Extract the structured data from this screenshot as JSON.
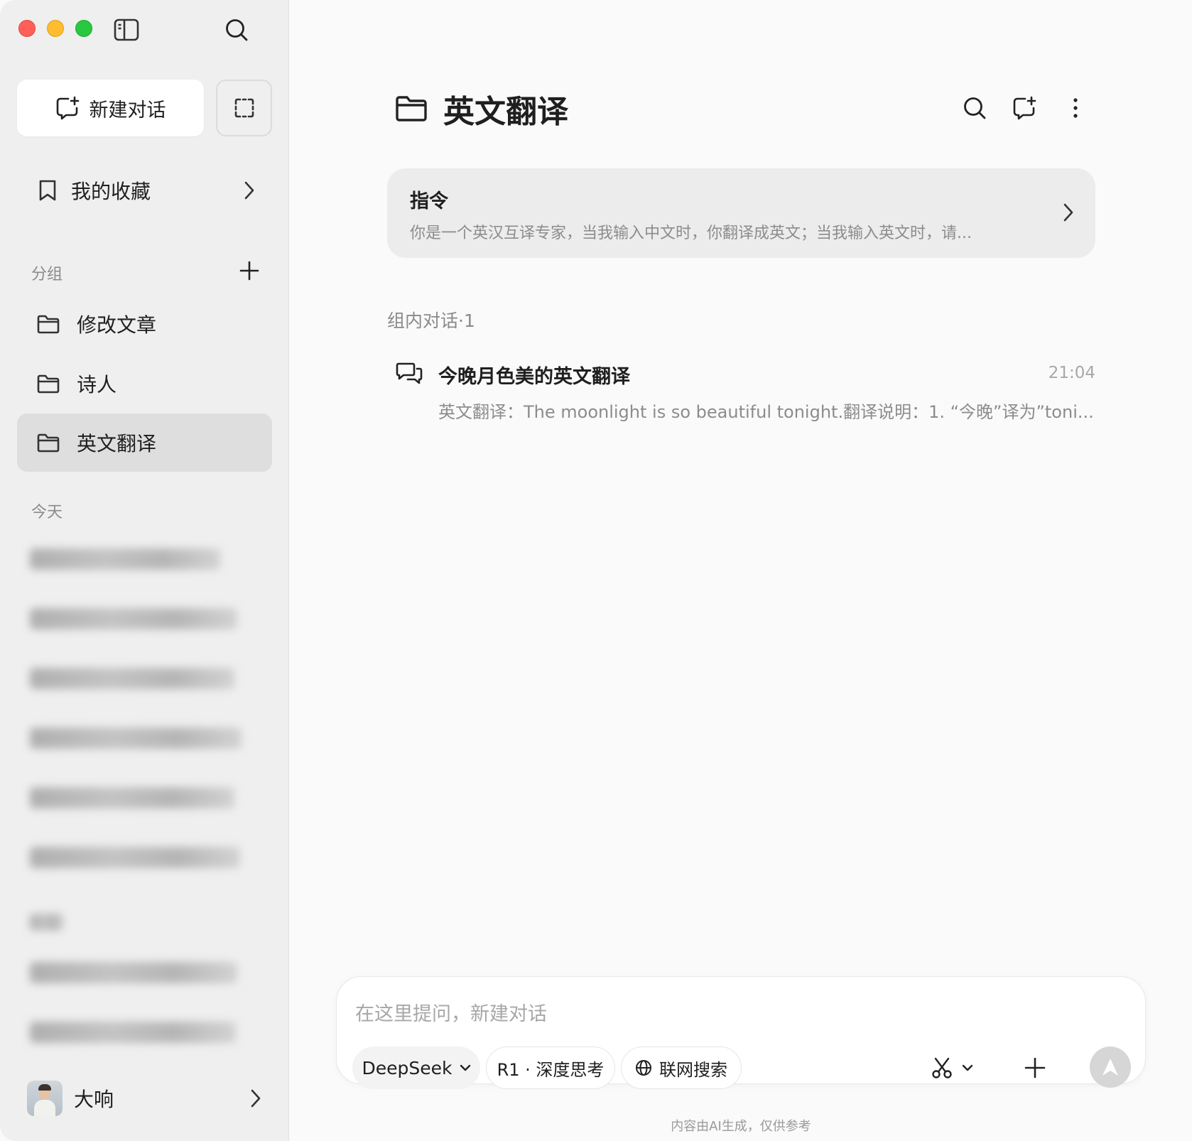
{
  "sidebar": {
    "new_chat_label": "新建对话",
    "favorites_label": "我的收藏",
    "groups_section_label": "分组",
    "groups": [
      {
        "label": "修改文章",
        "active": false
      },
      {
        "label": "诗人",
        "active": false
      },
      {
        "label": "英文翻译",
        "active": true
      }
    ],
    "today_section_label": "今天",
    "user_name": "大响"
  },
  "main": {
    "title": "英文翻译",
    "instruction": {
      "title": "指令",
      "text": "你是一个英汉互译专家，当我输入中文时，你翻译成英文；当我输入英文时，请..."
    },
    "group_conversations_label": "组内对话·1",
    "conversations": [
      {
        "title": "今晚月色美的英文翻译",
        "time": "21:04",
        "preview": "英文翻译：The moonlight is so beautiful tonight.翻译说明：1. “今晚”译为”toni..."
      }
    ]
  },
  "composer": {
    "placeholder": "在这里提问，新建对话",
    "model_label": "DeepSeek",
    "think_label": "R1 · 深度思考",
    "web_search_label": "联网搜索"
  },
  "footer": {
    "disclaimer": "内容由AI生成，仅供参考"
  },
  "colors": {
    "sidebar_bg": "#efefef",
    "main_bg": "#fafafa",
    "active_group_bg": "#dedede",
    "traffic_red": "#ff5f57",
    "traffic_yellow": "#febc2e",
    "traffic_green": "#28c840"
  },
  "icons": {
    "sidebar_toggle": "sidebar-toggle-icon",
    "search": "search-icon",
    "new_chat": "new-chat-icon",
    "select": "select-icon",
    "bookmark": "bookmark-icon",
    "add": "plus-icon",
    "folder": "folder-icon",
    "more": "more-vertical-icon",
    "chat": "chat-bubbles-icon",
    "scissors": "scissors-icon",
    "globe": "globe-icon",
    "send": "send-icon"
  }
}
